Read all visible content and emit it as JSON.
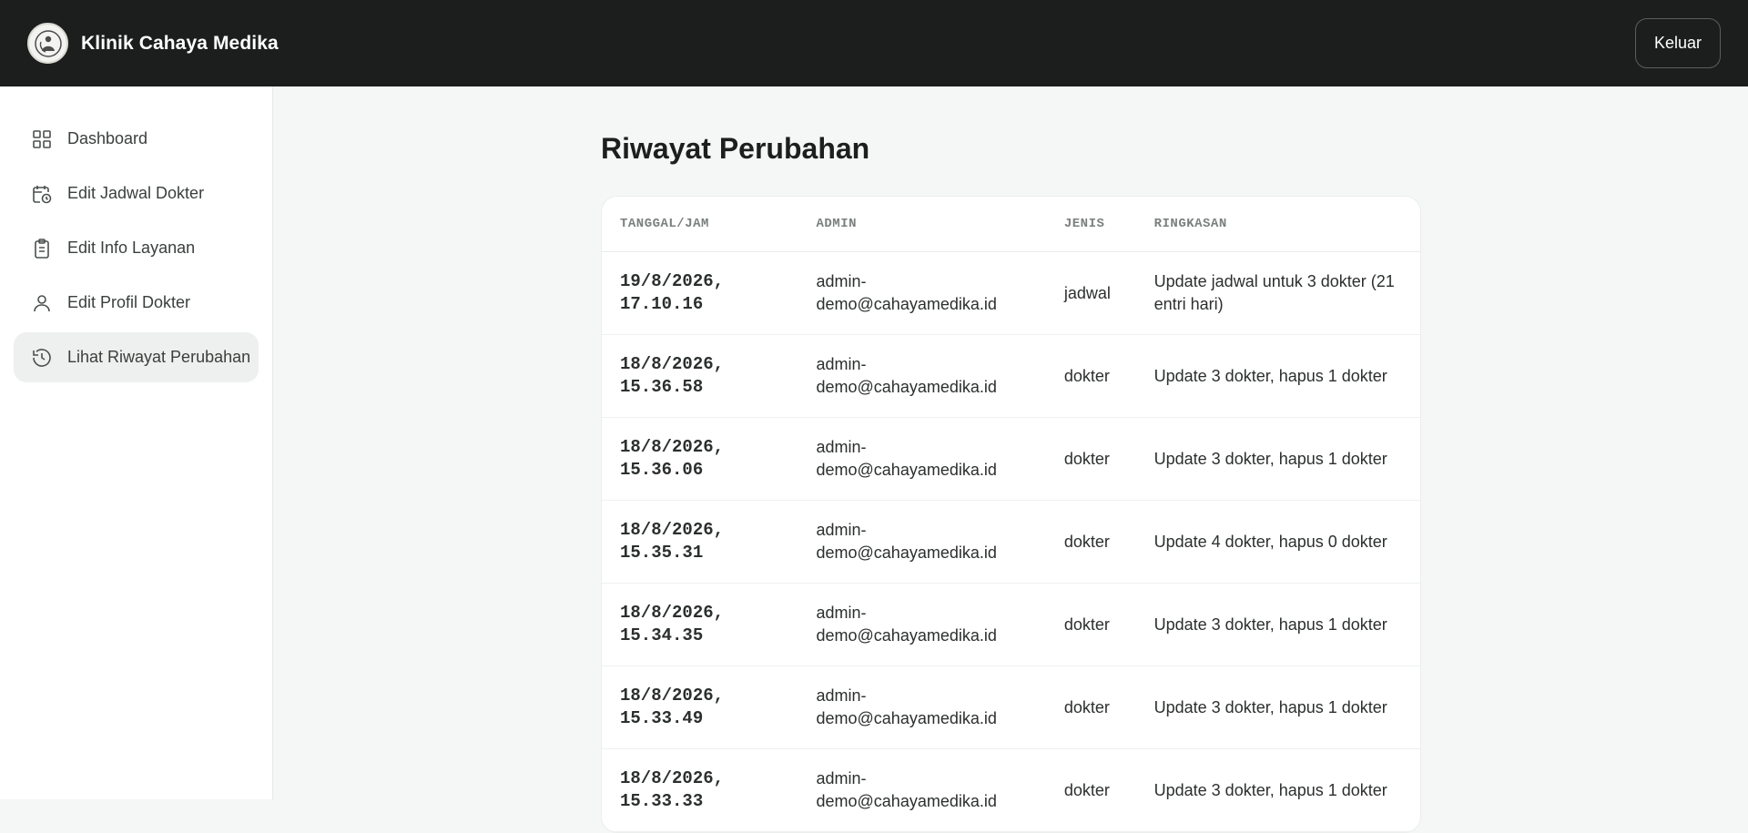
{
  "header": {
    "brand": "Klinik Cahaya Medika",
    "logout_label": "Keluar"
  },
  "sidebar": {
    "items": [
      {
        "label": "Dashboard",
        "icon": "grid-icon"
      },
      {
        "label": "Edit Jadwal Dokter",
        "icon": "calendar-clock-icon"
      },
      {
        "label": "Edit Info Layanan",
        "icon": "clipboard-icon"
      },
      {
        "label": "Edit Profil Dokter",
        "icon": "user-icon"
      },
      {
        "label": "Lihat Riwayat Perubahan",
        "icon": "history-icon",
        "active": true
      }
    ]
  },
  "main": {
    "title": "Riwayat Perubahan",
    "table": {
      "headers": [
        "TANGGAL/JAM",
        "ADMIN",
        "JENIS",
        "RINGKASAN"
      ],
      "rows": [
        {
          "datetime": "19/8/2026,\n17.10.16",
          "admin": "admin-\ndemo@cahayamedika.id",
          "type": "jadwal",
          "summary": "Update jadwal untuk 3 dokter (21 entri hari)"
        },
        {
          "datetime": "18/8/2026,\n15.36.58",
          "admin": "admin-\ndemo@cahayamedika.id",
          "type": "dokter",
          "summary": "Update 3 dokter, hapus 1 dokter"
        },
        {
          "datetime": "18/8/2026,\n15.36.06",
          "admin": "admin-\ndemo@cahayamedika.id",
          "type": "dokter",
          "summary": "Update 3 dokter, hapus 1 dokter"
        },
        {
          "datetime": "18/8/2026,\n15.35.31",
          "admin": "admin-\ndemo@cahayamedika.id",
          "type": "dokter",
          "summary": "Update 4 dokter, hapus 0 dokter"
        },
        {
          "datetime": "18/8/2026,\n15.34.35",
          "admin": "admin-\ndemo@cahayamedika.id",
          "type": "dokter",
          "summary": "Update 3 dokter, hapus 1 dokter"
        },
        {
          "datetime": "18/8/2026,\n15.33.49",
          "admin": "admin-\ndemo@cahayamedika.id",
          "type": "dokter",
          "summary": "Update 3 dokter, hapus 1 dokter"
        },
        {
          "datetime": "18/8/2026,\n15.33.33",
          "admin": "admin-\ndemo@cahayamedika.id",
          "type": "dokter",
          "summary": "Update 3 dokter, hapus 1 dokter"
        }
      ]
    }
  }
}
